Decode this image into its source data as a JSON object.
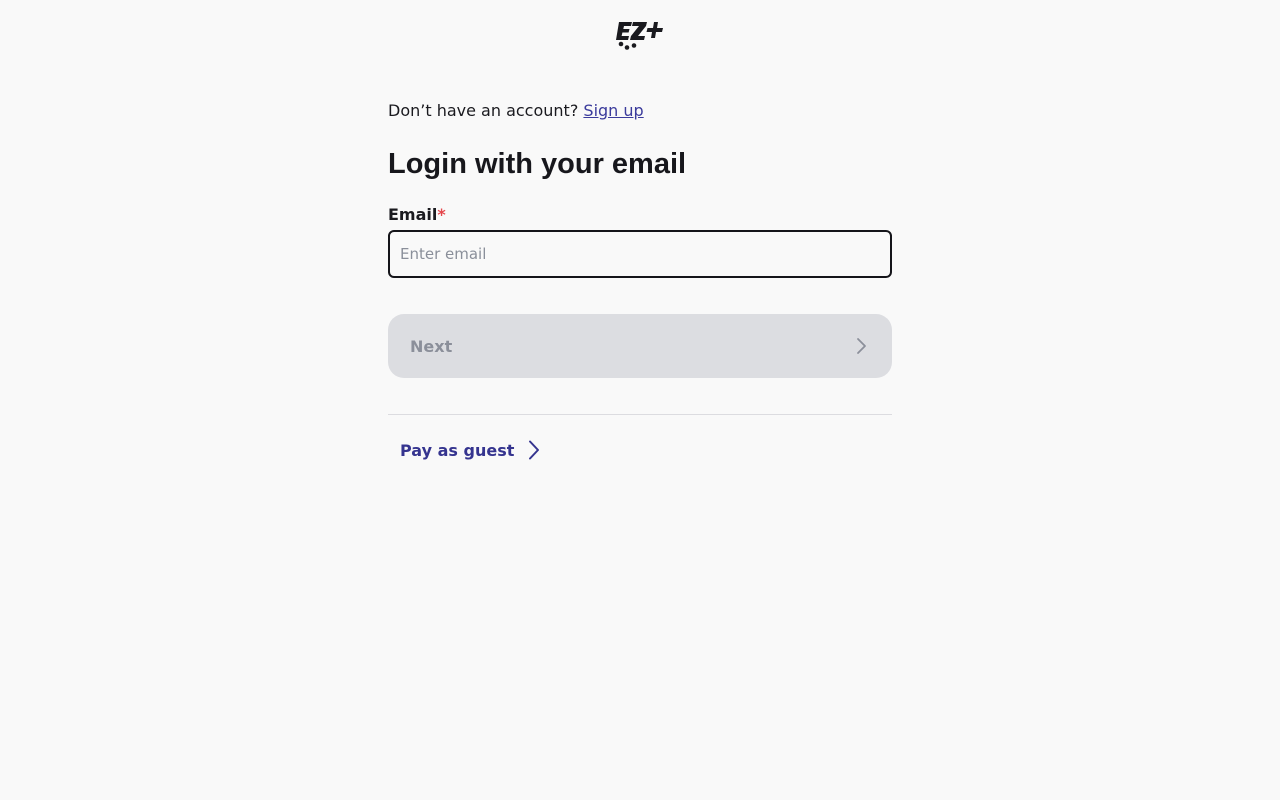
{
  "brand": {
    "logo_text": "EZ+",
    "logo_icon": "ez-plus-logo"
  },
  "signup": {
    "prompt": "Don’t have an account?",
    "link_label": "Sign up"
  },
  "login": {
    "heading": "Login with your email",
    "email_label": "Email",
    "required_mark": "*",
    "email_placeholder": "Enter email",
    "email_value": "",
    "next_label": "Next",
    "next_icon": "chevron-right-icon",
    "next_disabled": true
  },
  "guest": {
    "label": "Pay as guest",
    "icon": "chevron-right-icon"
  },
  "colors": {
    "background": "#f9f9f9",
    "link": "#3b3b9c",
    "guest_link": "#35348f",
    "required": "#e5484d",
    "disabled_button_bg": "#dcdde1",
    "disabled_button_text": "#8b8f9a"
  }
}
